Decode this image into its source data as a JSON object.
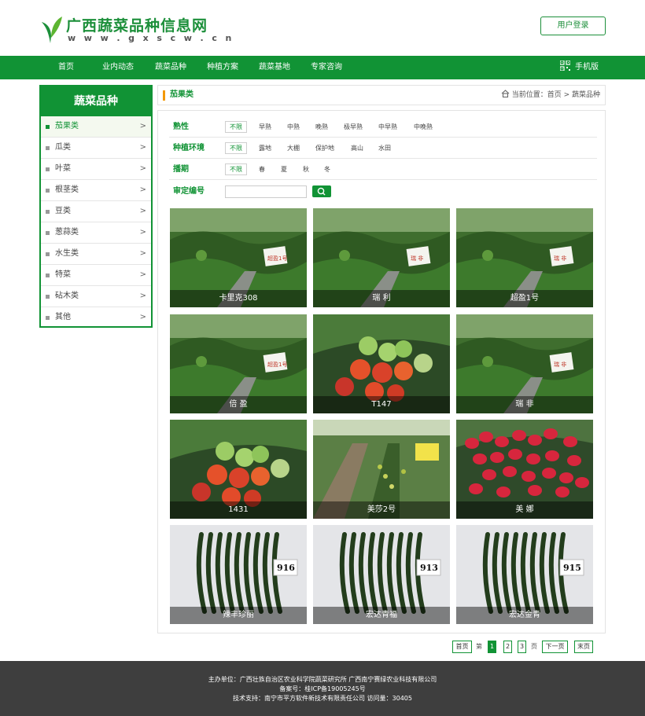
{
  "header": {
    "logo_title": "广西蔬菜品种信息网",
    "logo_url": "w w w . g x s c w . c n",
    "login_label": "用户登录"
  },
  "nav": {
    "items": [
      "首页",
      "业内动态",
      "蔬菜品种",
      "种植方案",
      "蔬菜基地",
      "专家咨询"
    ],
    "mobile_label": "手机版"
  },
  "sidebar": {
    "title": "蔬菜品种",
    "items": [
      {
        "label": "茄果类",
        "arrow": ">",
        "active": true
      },
      {
        "label": "瓜类",
        "arrow": ">"
      },
      {
        "label": "叶菜",
        "arrow": ">"
      },
      {
        "label": "根茎类",
        "arrow": ">"
      },
      {
        "label": "豆类",
        "arrow": ">"
      },
      {
        "label": "葱蒜类",
        "arrow": ">"
      },
      {
        "label": "水生类",
        "arrow": ">"
      },
      {
        "label": "特菜",
        "arrow": ">"
      },
      {
        "label": "砧木类",
        "arrow": ">"
      },
      {
        "label": "其他",
        "arrow": ">"
      }
    ]
  },
  "titlebar": {
    "title": "茄果类",
    "breadcrumb_prefix": "当前位置：",
    "breadcrumb": [
      "首页",
      "蔬菜品种"
    ],
    "separator": " > "
  },
  "filters": {
    "maturity": {
      "label": "熟性",
      "options": [
        "不限",
        "早熟",
        "中熟",
        "晚熟",
        "极早熟",
        "中早熟",
        "中晚熟"
      ]
    },
    "environment": {
      "label": "种植环境",
      "options": [
        "不限",
        "露地",
        "大棚",
        "保护地",
        "高山",
        "水田"
      ]
    },
    "season": {
      "label": "播期",
      "options": [
        "不限",
        "春",
        "夏",
        "秋",
        "冬"
      ]
    },
    "code": {
      "label": "审定编号",
      "value": "",
      "placeholder": ""
    }
  },
  "products": [
    {
      "name": "卡里克308",
      "photo": "tomato-greenhouse"
    },
    {
      "name": "瑞 利",
      "photo": "tomato-greenhouse"
    },
    {
      "name": "超盈1号",
      "photo": "tomato-greenhouse"
    },
    {
      "name": "倍 盈",
      "photo": "tomato-greenhouse"
    },
    {
      "name": "T147",
      "photo": "tomato-cluster"
    },
    {
      "name": "瑞 非",
      "photo": "tomato-greenhouse"
    },
    {
      "name": "1431",
      "photo": "tomato-cluster"
    },
    {
      "name": "美莎2号",
      "photo": "cherry-tomato-field"
    },
    {
      "name": "美 娜",
      "photo": "cherry-tomato-cluster"
    },
    {
      "name": "辣丰珍丽",
      "photo": "green-pepper",
      "tag": "916"
    },
    {
      "name": "宏达青福",
      "photo": "green-pepper",
      "tag": "913"
    },
    {
      "name": "宏达金青",
      "photo": "green-pepper",
      "tag": "915"
    }
  ],
  "photo_labels": {
    "c1": "超盈1号",
    "c3": "瑞 非",
    "c5": "瑞 非"
  },
  "pagination": {
    "first": "首页",
    "prefix": "第",
    "pages": [
      "1",
      "2",
      "3"
    ],
    "current": "1",
    "suffix": "页",
    "next": "下一页",
    "last": "末页"
  },
  "footer": {
    "line1": "主办单位：广西壮族自治区农业科学院蔬菜研究所 广西南宁赛绿农业科技有限公司",
    "line2": "备案号：桂ICP备19005245号",
    "line3": "技术支持：南宁市平方软件新技术有限责任公司 访问量：30405"
  },
  "colors": {
    "brand_green": "#119335",
    "accent_orange": "#f39800",
    "footer_bg": "#3e3e3e"
  }
}
